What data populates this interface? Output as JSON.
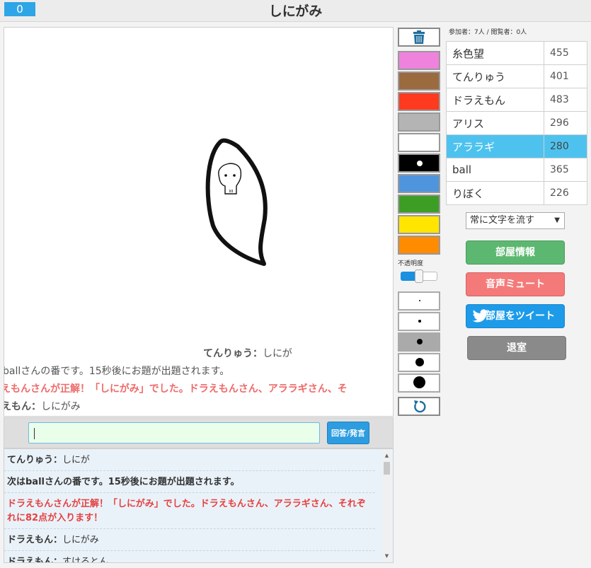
{
  "header": {
    "timer": "0",
    "title": "しにがみ"
  },
  "canvas": {
    "flow_messages": [
      {
        "speaker": "てんりゅう：",
        "text": "しにが"
      },
      {
        "text": "ballさんの番です。15秒後にお題が出題されます。"
      },
      {
        "text": "えもんさんが正解！「しにがみ」でした。ドラえもんさん、アララギさん、そ"
      },
      {
        "speaker": "えもん：",
        "text": "しにがみ"
      }
    ]
  },
  "chat_input": {
    "value": "",
    "button_label": "回答/発言"
  },
  "log": [
    {
      "speaker": "てんりゅう：",
      "text": "しにが"
    },
    {
      "text": "次はballさんの番です。15秒後にお題が出題されます。"
    },
    {
      "text": "ドラえもんさんが正解！「しにがみ」でした。ドラえもんさん、アララギさん、それぞれに82点が入ります！"
    },
    {
      "speaker": "ドラえもん：",
      "text": "しにがみ"
    },
    {
      "speaker": "ドラえもん：",
      "text": "すけるとん"
    }
  ],
  "tools": {
    "colors": [
      "#ee82dd",
      "#9c6a3f",
      "#ff3a1f",
      "#b4b4b4",
      "#ffffff",
      "#000000",
      "#4f95dd",
      "#3d9e26",
      "#ffe500",
      "#ff8c00"
    ],
    "selected_color": "#000000",
    "opacity_label": "不透明度",
    "opacity_percent": 50
  },
  "room": {
    "counts": "参加者：7人 / 閲覧者：0人",
    "players": [
      {
        "name": "糸色望",
        "score": "455"
      },
      {
        "name": "てんりゅう",
        "score": "401"
      },
      {
        "name": "ドラえもん",
        "score": "483"
      },
      {
        "name": "アリス",
        "score": "296"
      },
      {
        "name": "アララギ",
        "score": "280"
      },
      {
        "name": "ball",
        "score": "365"
      },
      {
        "name": "りぼく",
        "score": "226"
      }
    ],
    "active_player": "アララギ",
    "text_flow_select": "常に文字を流す",
    "buttons": {
      "info": "部屋情報",
      "mute": "音声ミュート",
      "tweet": "部屋をツイート",
      "leave": "退室"
    }
  }
}
